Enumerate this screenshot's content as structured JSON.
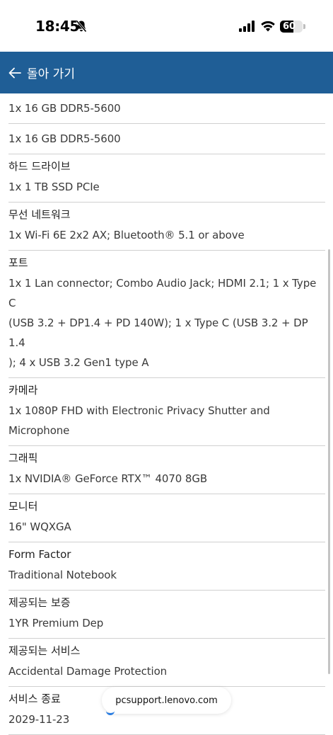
{
  "status_bar": {
    "time": "18:45",
    "battery_level": "60",
    "battery_fraction": 0.6
  },
  "header": {
    "back_label": "돌아 가기",
    "background": "#1f5e96"
  },
  "specs": [
    {
      "label": "",
      "values": [
        "1x 16 GB DDR5-5600"
      ]
    },
    {
      "label": "",
      "values": [
        "1x 16 GB DDR5-5600"
      ]
    },
    {
      "label": "하드 드라이브",
      "values": [
        "1x 1 TB SSD PCIe"
      ]
    },
    {
      "label": "무선 네트워크",
      "values": [
        "1x Wi-Fi 6E 2x2 AX; Bluetooth® 5.1 or above"
      ]
    },
    {
      "label": "포트",
      "values": [
        "1x 1 Lan connector; Combo Audio Jack; HDMI 2.1; 1 x Type C",
        "(USB 3.2 + DP1.4 + PD 140W); 1 x Type C (USB 3.2 + DP 1.4",
        "); 4 x USB 3.2 Gen1 type A"
      ]
    },
    {
      "label": "카메라",
      "values": [
        "1x 1080P FHD with Electronic Privacy Shutter and",
        "Microphone"
      ]
    },
    {
      "label": "그래픽",
      "values": [
        "1x NVIDIA® GeForce RTX™ 4070 8GB"
      ]
    },
    {
      "label": "모니터",
      "values": [
        "16\" WQXGA"
      ]
    },
    {
      "label": "Form Factor",
      "values": [
        "Traditional Notebook"
      ]
    },
    {
      "label": "제공되는 보증",
      "values": [
        "1YR Premium Dep"
      ]
    },
    {
      "label": "제공되는 서비스",
      "values": [
        "Accidental Damage Protection"
      ]
    },
    {
      "label": "서비스 종료",
      "values": [
        "2029-11-23"
      ]
    }
  ],
  "browser": {
    "url": "pcsupport.lenovo.com"
  }
}
